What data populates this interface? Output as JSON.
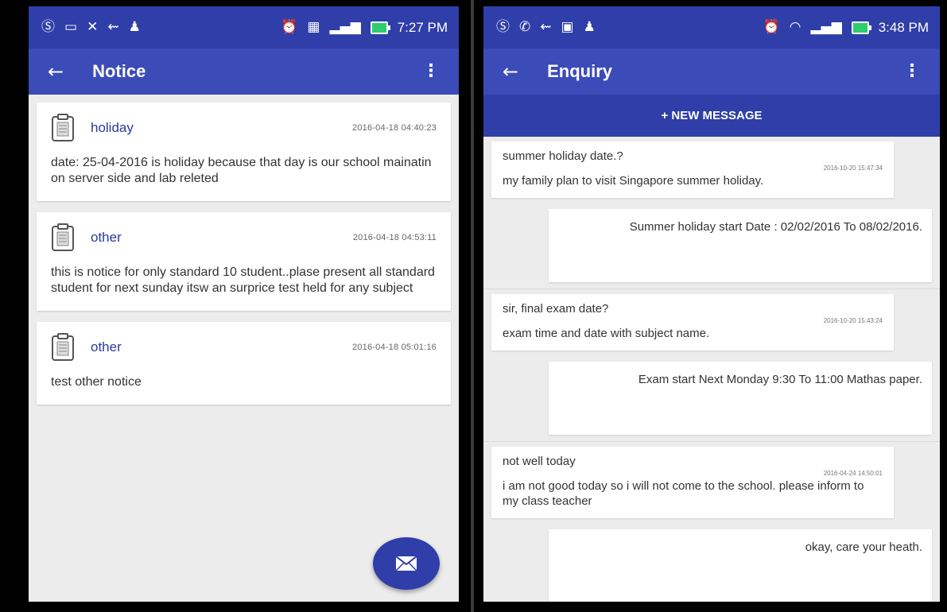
{
  "left_screen": {
    "status": {
      "time": "7:27 PM"
    },
    "appbar": {
      "title": "Notice"
    },
    "notices": [
      {
        "type": "holiday",
        "date": "2016-04-18 04:40:23",
        "body": "date: 25-04-2016 is holiday because that day is our school mainatin on server side and lab releted"
      },
      {
        "type": "other",
        "date": "2016-04-18 04:53:11",
        "body": "this is notice for only standard 10 student..plase present all standard student for next sunday itsw an surprice test held for any subject"
      },
      {
        "type": "other",
        "date": "2016-04-18 05:01:16",
        "body": "test other notice"
      }
    ],
    "fab_icon": "mail-icon"
  },
  "right_screen": {
    "status": {
      "time": "3:48 PM"
    },
    "appbar": {
      "title": "Enquiry"
    },
    "new_message_label": "+ NEW MESSAGE",
    "threads": [
      {
        "subject": "summer holiday date.?",
        "date": "2016-10-20 15:47:34",
        "body": "my family plan to visit Singapore summer holiday.",
        "reply": "Summer holiday start Date : 02/02/2016 To 08/02/2016."
      },
      {
        "subject": "sir, final exam date?",
        "date": "2016-10-20 15:43:24",
        "body": "exam time and date with subject name.",
        "reply": "Exam start Next Monday 9:30 To 11:00 Mathas paper."
      },
      {
        "subject": "not well today",
        "date": "2016-04-24 14:50:01",
        "body": "i am not good today so i will not come to the school. please inform to my class teacher",
        "reply": "okay, care your heath."
      }
    ]
  },
  "colors": {
    "primary_dark": "#2f3ea8",
    "primary": "#3b4cb8",
    "accent_text": "#2a3a9c",
    "background": "#ececec"
  }
}
